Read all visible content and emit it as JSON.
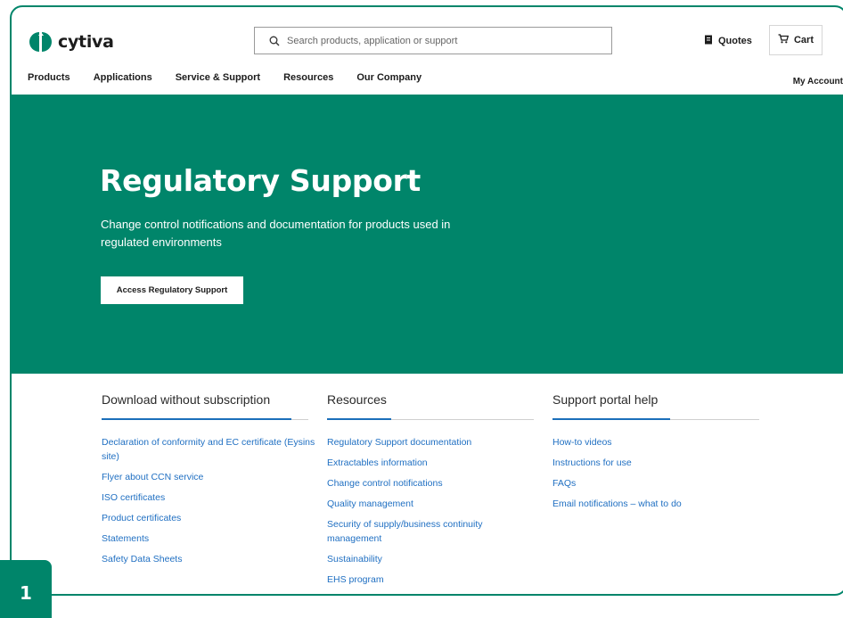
{
  "header": {
    "logo_text": "cytiva",
    "search_placeholder": "Search products, application or support",
    "quotes_label": "Quotes",
    "cart_label": "Cart",
    "my_account_label": "My Account"
  },
  "nav": {
    "items": [
      "Products",
      "Applications",
      "Service & Support",
      "Resources",
      "Our Company"
    ]
  },
  "hero": {
    "title": "Regulatory Support",
    "description": "Change control notifications and documentation for products used in regulated environments",
    "button_label": "Access Regulatory Support"
  },
  "columns": [
    {
      "heading": "Download without subscription",
      "links": [
        "Declaration of conformity and EC certificate (Eysins site)",
        "Flyer about CCN service",
        "ISO certificates",
        "Product certificates",
        "Statements",
        "Safety Data Sheets"
      ]
    },
    {
      "heading": "Resources",
      "links": [
        "Regulatory Support documentation",
        "Extractables information",
        "Change control notifications",
        "Quality management",
        "Security of supply/business continuity management",
        "Sustainability",
        "EHS program"
      ]
    },
    {
      "heading": "Support portal help",
      "links": [
        "How-to videos",
        "Instructions for use",
        "FAQs",
        "Email notifications – what to do"
      ]
    }
  ],
  "badge_number": "1",
  "colors": {
    "brand_green": "#00856a",
    "link_blue": "#1f6fc2",
    "accent_rule": "#1b6fba"
  },
  "icons": [
    "cytiva-logo-icon",
    "search-icon",
    "quotes-icon",
    "cart-icon"
  ]
}
